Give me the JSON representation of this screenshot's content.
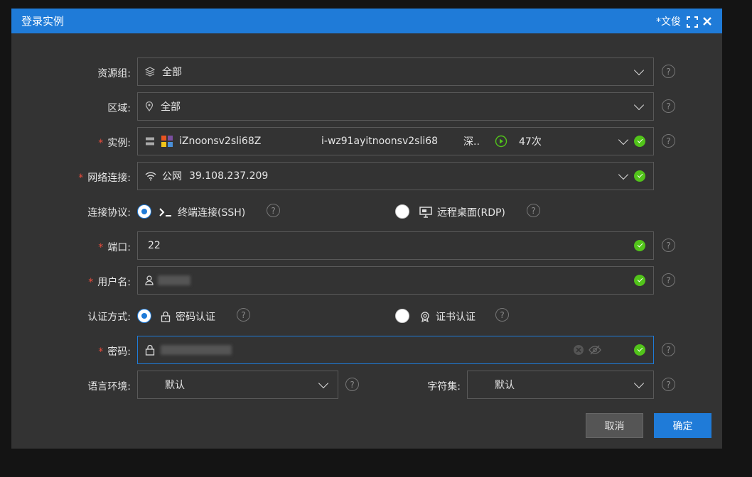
{
  "dialog": {
    "title": "登录实例",
    "user": "*文俊"
  },
  "form": {
    "resource_group": {
      "label": "资源组:",
      "value": "全部"
    },
    "region": {
      "label": "区域:",
      "value": "全部"
    },
    "instance": {
      "label": "实例:",
      "name": "iZnoonsv2sli68Z",
      "id": "i-wz91ayitnoonsv2sli68",
      "region_short": "深..",
      "count": "47次"
    },
    "network": {
      "label": "网络连接:",
      "type": "公网",
      "ip": "39.108.237.209"
    },
    "protocol": {
      "label": "连接协议:",
      "ssh": "终端连接(SSH)",
      "rdp": "远程桌面(RDP)"
    },
    "port": {
      "label": "端口:",
      "value": "22"
    },
    "username": {
      "label": "用户名:"
    },
    "auth": {
      "label": "认证方式:",
      "password": "密码认证",
      "cert": "证书认证"
    },
    "password": {
      "label": "密码:"
    },
    "locale": {
      "label": "语言环境:",
      "value": "默认"
    },
    "charset": {
      "label": "字符集:",
      "value": "默认"
    }
  },
  "buttons": {
    "cancel": "取消",
    "confirm": "确定"
  },
  "help_glyph": "?",
  "colors": {
    "accent": "#1f7bd8",
    "success": "#52c41a",
    "required": "#e74c3c"
  }
}
